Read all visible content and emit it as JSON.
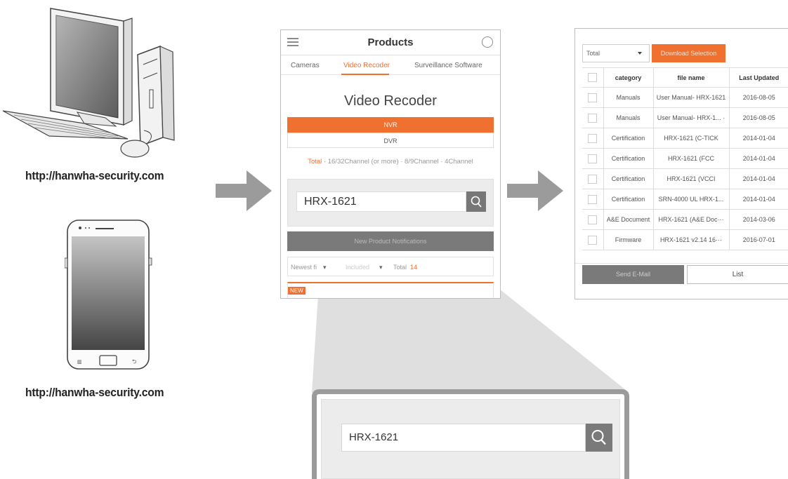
{
  "captions": {
    "desktop_url": "http://hanwha-security.com",
    "mobile_url": "http://hanwha-security.com"
  },
  "colors": {
    "accent": "#f07030",
    "arrow": "#9b9b9b",
    "dark_button": "#7a7a7a"
  },
  "products_screen": {
    "title": "Products",
    "tabs": [
      {
        "label": "Cameras",
        "active": false
      },
      {
        "label": "Video Recoder",
        "active": true
      },
      {
        "label": "Surveillance Software",
        "active": false
      }
    ],
    "heading": "Video Recoder",
    "segments": [
      {
        "label": "NVR",
        "active": true
      },
      {
        "label": "DVR",
        "active": false
      }
    ],
    "filters": [
      {
        "label": "Total",
        "active": true
      },
      {
        "label": "16/32Channel (or more)",
        "active": false
      },
      {
        "label": "8/9Channel",
        "active": false
      },
      {
        "label": "4Channel",
        "active": false
      }
    ],
    "search": {
      "value": "HRX-1621"
    },
    "notifications_label": "New Product Notifications",
    "sort": {
      "order": "Newest fi",
      "included": "Included",
      "total_label": "Total",
      "total_count": "14"
    },
    "new_badge": "NEW"
  },
  "download_screen": {
    "filter_select": "Total",
    "download_button": "Download Selection",
    "columns": [
      "category",
      "file name",
      "Last Updated"
    ],
    "rows": [
      {
        "category": "Manuals",
        "file_name": "User Manual- HRX-1621",
        "updated": "2016-08-05"
      },
      {
        "category": "Manuals",
        "file_name": "User Manual- HRX-1... ·",
        "updated": "2016-08-05"
      },
      {
        "category": "Certification",
        "file_name": "HRX-1621 (C-TICK",
        "updated": "2014-01-04"
      },
      {
        "category": "Certification",
        "file_name": "HRX-1621 (FCC",
        "updated": "2014-01-04"
      },
      {
        "category": "Certification",
        "file_name": "HRX-1621 (VCCI",
        "updated": "2014-01-04"
      },
      {
        "category": "Certification",
        "file_name": "SRN-4000 UL HRX-1...",
        "updated": "2014-01-04"
      },
      {
        "category": "A&E Document",
        "file_name": "HRX-1621 (A&E Doc···",
        "updated": "2014-03-06"
      },
      {
        "category": "Firmware",
        "file_name": "HRX-1621 v2.14 16···",
        "updated": "2016-07-01"
      }
    ],
    "send_email_button": "Send E-Mail",
    "list_button": "List"
  },
  "zoom": {
    "search_value": "HRX-1621"
  }
}
